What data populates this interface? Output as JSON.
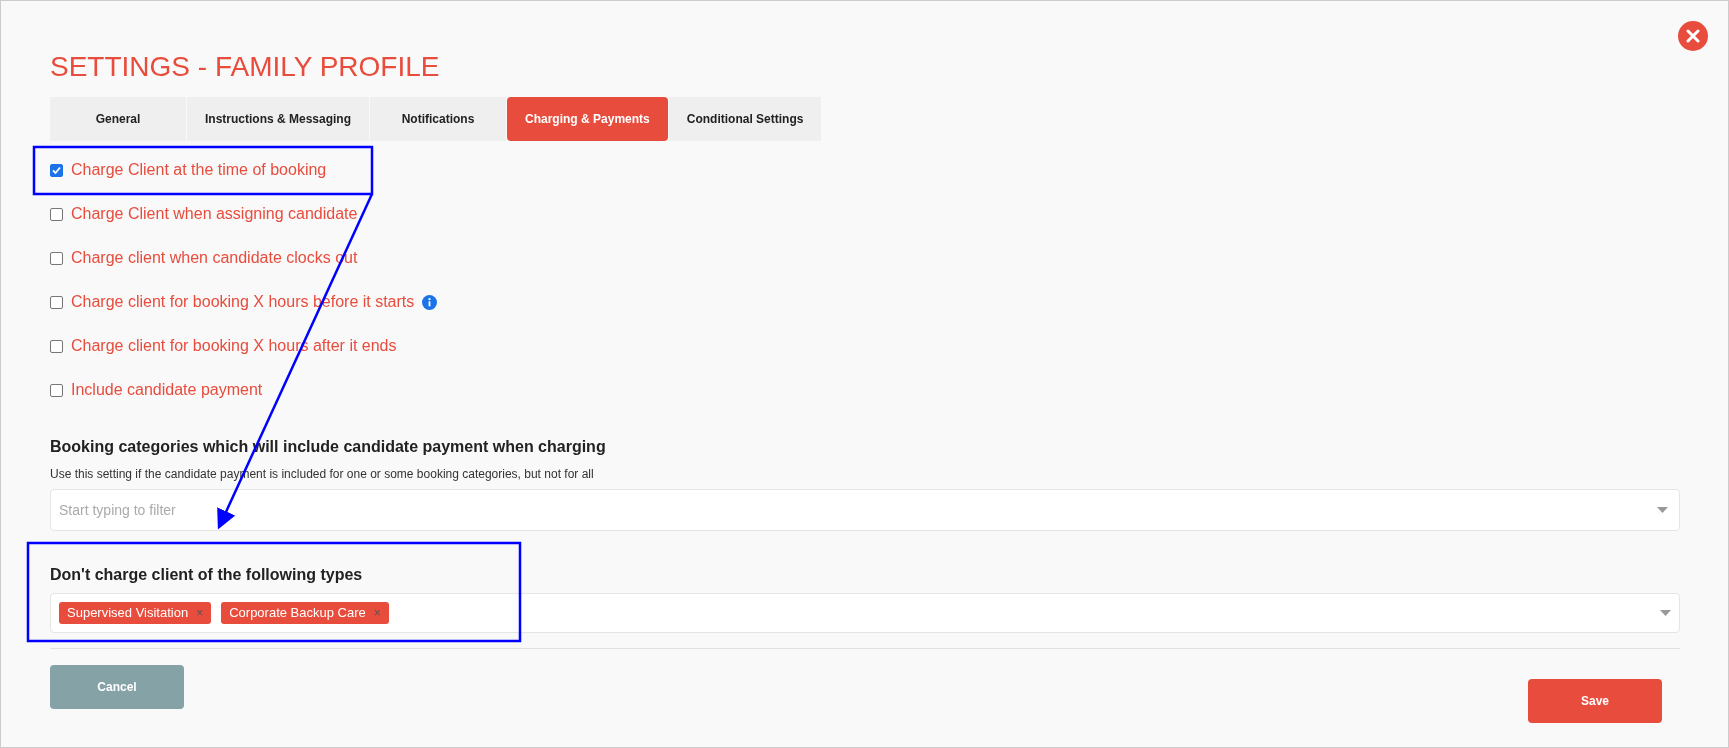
{
  "title": "SETTINGS - FAMILY PROFILE",
  "tabs": [
    {
      "label": "General",
      "selected": false
    },
    {
      "label": "Instructions & Messaging",
      "selected": false
    },
    {
      "label": "Notifications",
      "selected": false
    },
    {
      "label": "Charging & Payments",
      "selected": true
    },
    {
      "label": "Conditional Settings",
      "selected": false
    }
  ],
  "options": [
    {
      "label": "Charge Client at the time of booking",
      "checked": true,
      "info": false
    },
    {
      "label": "Charge Client when assigning candidate",
      "checked": false,
      "info": false
    },
    {
      "label": "Charge client when candidate clocks out",
      "checked": false,
      "info": false
    },
    {
      "label": "Charge client for booking X hours before it starts",
      "checked": false,
      "info": true
    },
    {
      "label": "Charge client for booking X hours after it ends",
      "checked": false,
      "info": false
    },
    {
      "label": "Include candidate payment",
      "checked": false,
      "info": false
    }
  ],
  "booking_categories": {
    "heading": "Booking categories which will include candidate payment when charging",
    "hint": "Use this setting if the candidate payment is included for one or some booking categories, but not for all",
    "placeholder": "Start typing to filter"
  },
  "excluded_types": {
    "heading": "Don't charge client of the following types",
    "tags": [
      {
        "label": "Supervised Visitation",
        "remove": "×"
      },
      {
        "label": "Corporate Backup Care",
        "remove": "×"
      }
    ]
  },
  "buttons": {
    "cancel": "Cancel",
    "save": "Save"
  }
}
